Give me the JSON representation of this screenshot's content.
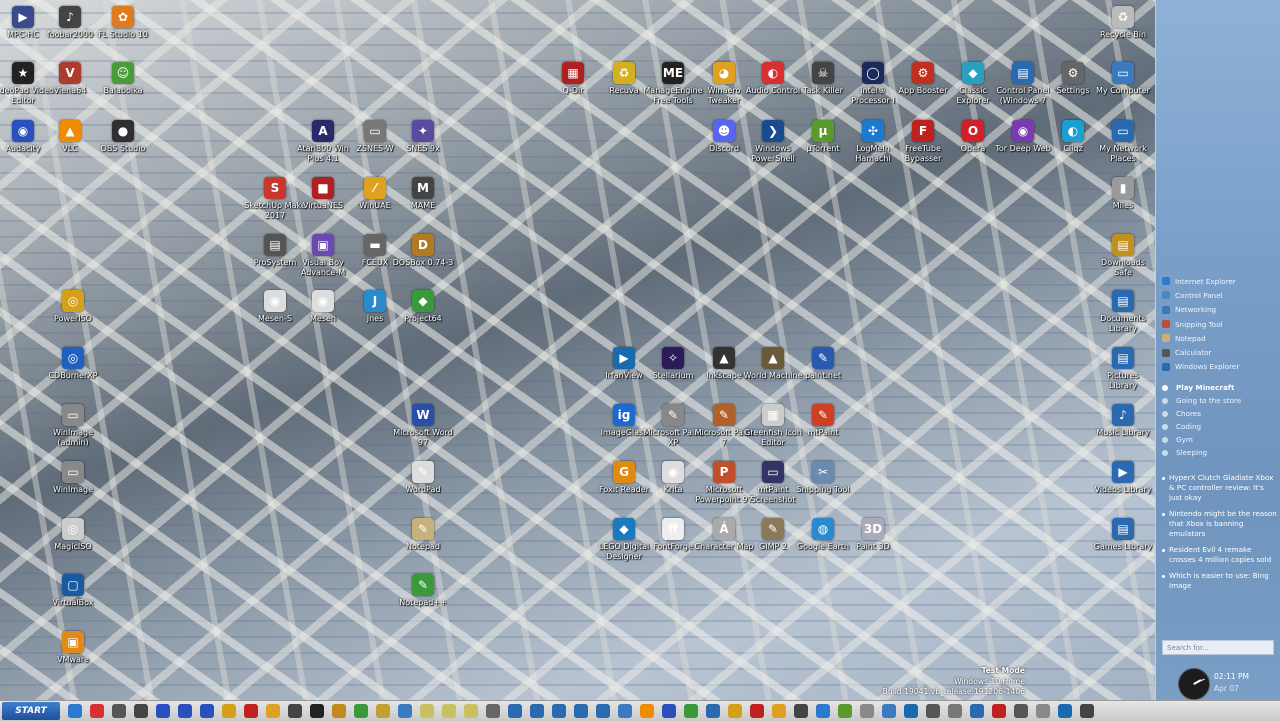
{
  "desktop": {
    "icons": [
      {
        "label": "MPC-HC",
        "color": "#3a4a8a",
        "glyph": "▶"
      },
      {
        "label": "foobar2000",
        "color": "#444",
        "glyph": "♪"
      },
      {
        "label": "FL Studio 10",
        "color": "#e07a1f",
        "glyph": "✿"
      },
      {
        "label": "VideoPad Video Editor",
        "color": "#222",
        "glyph": "★"
      },
      {
        "label": "Viena64",
        "color": "#b03a2e",
        "glyph": "V"
      },
      {
        "label": "Balabolka",
        "color": "#4a9b3a",
        "glyph": "☺"
      },
      {
        "label": "Audacity",
        "color": "#2a4fbf",
        "glyph": "◉"
      },
      {
        "label": "VLC",
        "color": "#f08a00",
        "glyph": "▲"
      },
      {
        "label": "OBS Studio",
        "color": "#302e31",
        "glyph": "●"
      },
      {
        "label": "Atari800 Win Plus 4.1",
        "color": "#2a2a6a",
        "glyph": "A"
      },
      {
        "label": "ZSNES-W",
        "color": "#777",
        "glyph": "▭"
      },
      {
        "label": "SNES 9x",
        "color": "#5a4aa0",
        "glyph": "✦"
      },
      {
        "label": "SketchUp Make 2017",
        "color": "#c8372d",
        "glyph": "S"
      },
      {
        "label": "VirtuaNES",
        "color": "#b02020",
        "glyph": "■"
      },
      {
        "label": "WinUAE",
        "color": "#e0a020",
        "glyph": "⁄"
      },
      {
        "label": "MAME",
        "color": "#444",
        "glyph": "M"
      },
      {
        "label": "ProSystem",
        "color": "#555",
        "glyph": "▤"
      },
      {
        "label": "Visual Boy Advance-M",
        "color": "#6a4ab0",
        "glyph": "▣"
      },
      {
        "label": "FCEUX",
        "color": "#666",
        "glyph": "▬"
      },
      {
        "label": "DOSBox 0.74-3",
        "color": "#b07a20",
        "glyph": "D"
      },
      {
        "label": "PowerISO",
        "color": "#d4a017",
        "glyph": "◎"
      },
      {
        "label": "Mesen-S",
        "color": "#ddd",
        "glyph": "◉"
      },
      {
        "label": "Mesen",
        "color": "#ddd",
        "glyph": "◉"
      },
      {
        "label": "Jnes",
        "color": "#2a8ad0",
        "glyph": "J"
      },
      {
        "label": "Project64",
        "color": "#3a9a3a",
        "glyph": "◆"
      },
      {
        "label": "CDBurnerXP",
        "color": "#2060c0",
        "glyph": "◎"
      },
      {
        "label": "WinImage (admin)",
        "color": "#888",
        "glyph": "▭"
      },
      {
        "label": "WinImage",
        "color": "#888",
        "glyph": "▭"
      },
      {
        "label": "MagicISO",
        "color": "#ccc",
        "glyph": "◎"
      },
      {
        "label": "VirtualBox",
        "color": "#1a5aa0",
        "glyph": "▢"
      },
      {
        "label": "VMware",
        "color": "#e08a1a",
        "glyph": "▣"
      },
      {
        "label": "Microsoft Word 97",
        "color": "#2a4fa8",
        "glyph": "W"
      },
      {
        "label": "WordPad",
        "color": "#ddd",
        "glyph": "✎"
      },
      {
        "label": "Notepad",
        "color": "#c9b27a",
        "glyph": "✎"
      },
      {
        "label": "Notepad++",
        "color": "#3a9a3a",
        "glyph": "✎"
      },
      {
        "label": "Q-Dir",
        "color": "#b02020",
        "glyph": "▦"
      },
      {
        "label": "Recuva",
        "color": "#d4b020",
        "glyph": "♻"
      },
      {
        "label": "ManageEngine Free Tools",
        "color": "#222",
        "glyph": "ME"
      },
      {
        "label": "Winaero Tweaker",
        "color": "#e0a020",
        "glyph": "◕"
      },
      {
        "label": "Audio Control",
        "color": "#d83030",
        "glyph": "◐"
      },
      {
        "label": "Task Killer",
        "color": "#444",
        "glyph": "☠"
      },
      {
        "label": "Intel® Processor I",
        "color": "#1a2a5a",
        "glyph": "◯"
      },
      {
        "label": "App Booster",
        "color": "#c03020",
        "glyph": "⚙"
      },
      {
        "label": "Classic Explorer",
        "color": "#2aa0c0",
        "glyph": "◆"
      },
      {
        "label": "Control Panel (Windows 7",
        "color": "#2a6ab0",
        "glyph": "▤"
      },
      {
        "label": "Settings",
        "color": "#666",
        "glyph": "⚙"
      },
      {
        "label": "My Computer",
        "color": "#3a7ac0",
        "glyph": "▭"
      },
      {
        "label": "Discord",
        "color": "#5865f2",
        "glyph": "☻"
      },
      {
        "label": "Windows PowerShell",
        "color": "#1a4a90",
        "glyph": "❯"
      },
      {
        "label": "µTorrent",
        "color": "#5a9a2a",
        "glyph": "µ"
      },
      {
        "label": "LogMeIn Hamachi",
        "color": "#1a7ad0",
        "glyph": "✣"
      },
      {
        "label": "FreeTube Bypasser",
        "color": "#c02020",
        "glyph": "F"
      },
      {
        "label": "Opera",
        "color": "#d0202a",
        "glyph": "O"
      },
      {
        "label": "Tor Deep Web",
        "color": "#7a3ab0",
        "glyph": "◉"
      },
      {
        "label": "Cliqz",
        "color": "#1aa0d0",
        "glyph": "◐"
      },
      {
        "label": "My Network Places",
        "color": "#2a6ab0",
        "glyph": "▭"
      },
      {
        "label": "Recycle Bin",
        "color": "#bbb",
        "glyph": "♻"
      },
      {
        "label": "Miles",
        "color": "#999",
        "glyph": "▮"
      },
      {
        "label": "Downloads Safe",
        "color": "#c09020",
        "glyph": "▤"
      },
      {
        "label": "Documents Library",
        "color": "#2a6ab0",
        "glyph": "▤"
      },
      {
        "label": "Pictures Library",
        "color": "#2a6ab0",
        "glyph": "▤"
      },
      {
        "label": "Music Library",
        "color": "#2a6ab0",
        "glyph": "♪"
      },
      {
        "label": "Videos Library",
        "color": "#2a6ab0",
        "glyph": "▶"
      },
      {
        "label": "Games Library",
        "color": "#2a6ab0",
        "glyph": "▤"
      },
      {
        "label": "IrfanView",
        "color": "#1a6ab0",
        "glyph": "▶"
      },
      {
        "label": "Stellarium",
        "color": "#2a1a5a",
        "glyph": "✧"
      },
      {
        "label": "Inkscape",
        "color": "#333",
        "glyph": "▲"
      },
      {
        "label": "World Machine",
        "color": "#6a5a3a",
        "glyph": "▲"
      },
      {
        "label": "paint.net",
        "color": "#2a5ab0",
        "glyph": "✎"
      },
      {
        "label": "ImageGlass",
        "color": "#1a6ad0",
        "glyph": "ig"
      },
      {
        "label": "Microsoft Paint XP",
        "color": "#888",
        "glyph": "✎"
      },
      {
        "label": "Microsoft Paint 7",
        "color": "#b0602a",
        "glyph": "✎"
      },
      {
        "label": "Greenfish Icon Editor",
        "color": "#ccc",
        "glyph": "▦"
      },
      {
        "label": "mtPaint",
        "color": "#d04020",
        "glyph": "✎"
      },
      {
        "label": "Foxit Reader",
        "color": "#e08a10",
        "glyph": "G"
      },
      {
        "label": "Krita",
        "color": "#ddd",
        "glyph": "◉"
      },
      {
        "label": "Microsoft Powerpoint 97",
        "color": "#c0502a",
        "glyph": "P"
      },
      {
        "label": "mtPaint Screenshot",
        "color": "#336",
        "glyph": "▭"
      },
      {
        "label": "Snipping Tool",
        "color": "#6a8ab0",
        "glyph": "✂"
      },
      {
        "label": "LEGO Digital Designer",
        "color": "#1a7ac0",
        "glyph": "◆"
      },
      {
        "label": "FontForge",
        "color": "#eee",
        "glyph": "ff"
      },
      {
        "label": "Character Map",
        "color": "#aaa",
        "glyph": "Á"
      },
      {
        "label": "GIMP 2",
        "color": "#8a7a5a",
        "glyph": "✎"
      },
      {
        "label": "Google Earth",
        "color": "#2a8ad0",
        "glyph": "◍"
      },
      {
        "label": "Paint 3D",
        "color": "#aab",
        "glyph": "3D"
      }
    ]
  },
  "sidebar": {
    "quick_launch": [
      {
        "label": "Internet Explorer",
        "color": "#2a7ad0"
      },
      {
        "label": "Control Panel",
        "color": "#4a8ac0"
      },
      {
        "label": "Networking",
        "color": "#3a7ab0"
      },
      {
        "label": "Snipping Tool",
        "color": "#c04a3a"
      },
      {
        "label": "Notepad",
        "color": "#c9b27a"
      },
      {
        "label": "Calculator",
        "color": "#555"
      },
      {
        "label": "Windows Explorer",
        "color": "#2a6ab0"
      }
    ],
    "todos": [
      {
        "label": "Play Minecraft",
        "active": true
      },
      {
        "label": "Going to the store",
        "active": false
      },
      {
        "label": "Chores",
        "active": false
      },
      {
        "label": "Coding",
        "active": false
      },
      {
        "label": "Gym",
        "active": false
      },
      {
        "label": "Sleeping",
        "active": false
      }
    ],
    "news": [
      "HyperX Clutch Gladiate Xbox & PC controller review: It's just okay",
      "Nintendo might be the reason that Xbox is banning emulators",
      "Resident Evil 4 remake crosses 4 million copies sold",
      "Which is easier to use: Bing Image"
    ],
    "search_placeholder": "Search for...",
    "clock_time": "02:11 PM",
    "clock_date": "Apr 07"
  },
  "watermark": {
    "line1": "Test Mode",
    "line2": "Windows 10 Home",
    "line3": "Build 19041.vb_release.191206-1406"
  },
  "taskbar": {
    "start_label": "START",
    "items": [
      "#2a7ad0",
      "#d83030",
      "#555",
      "#444",
      "#2a4fbf",
      "#2a4fbf",
      "#2a4fbf",
      "#d4a017",
      "#c02020",
      "#e0a020",
      "#444",
      "#222",
      "#c08a20",
      "#3a9a3a",
      "#c0a030",
      "#3a7ac0",
      "#c9c060",
      "#c9c060",
      "#c9c060",
      "#666",
      "#2a6ab0",
      "#2a6ab0",
      "#2a6ab0",
      "#2a6ab0",
      "#2a6ab0",
      "#3a7ac0",
      "#f08a00",
      "#2a4fbf",
      "#3a9a3a",
      "#2a6ab0",
      "#d4a017",
      "#c02020",
      "#e0a020",
      "#444",
      "#2a7ad0",
      "#5a9a2a",
      "#888",
      "#3a7ac0",
      "#1a6ab0",
      "#555",
      "#777",
      "#2a6ab0",
      "#c02020",
      "#555",
      "#888",
      "#1a6ab0",
      "#444"
    ]
  }
}
